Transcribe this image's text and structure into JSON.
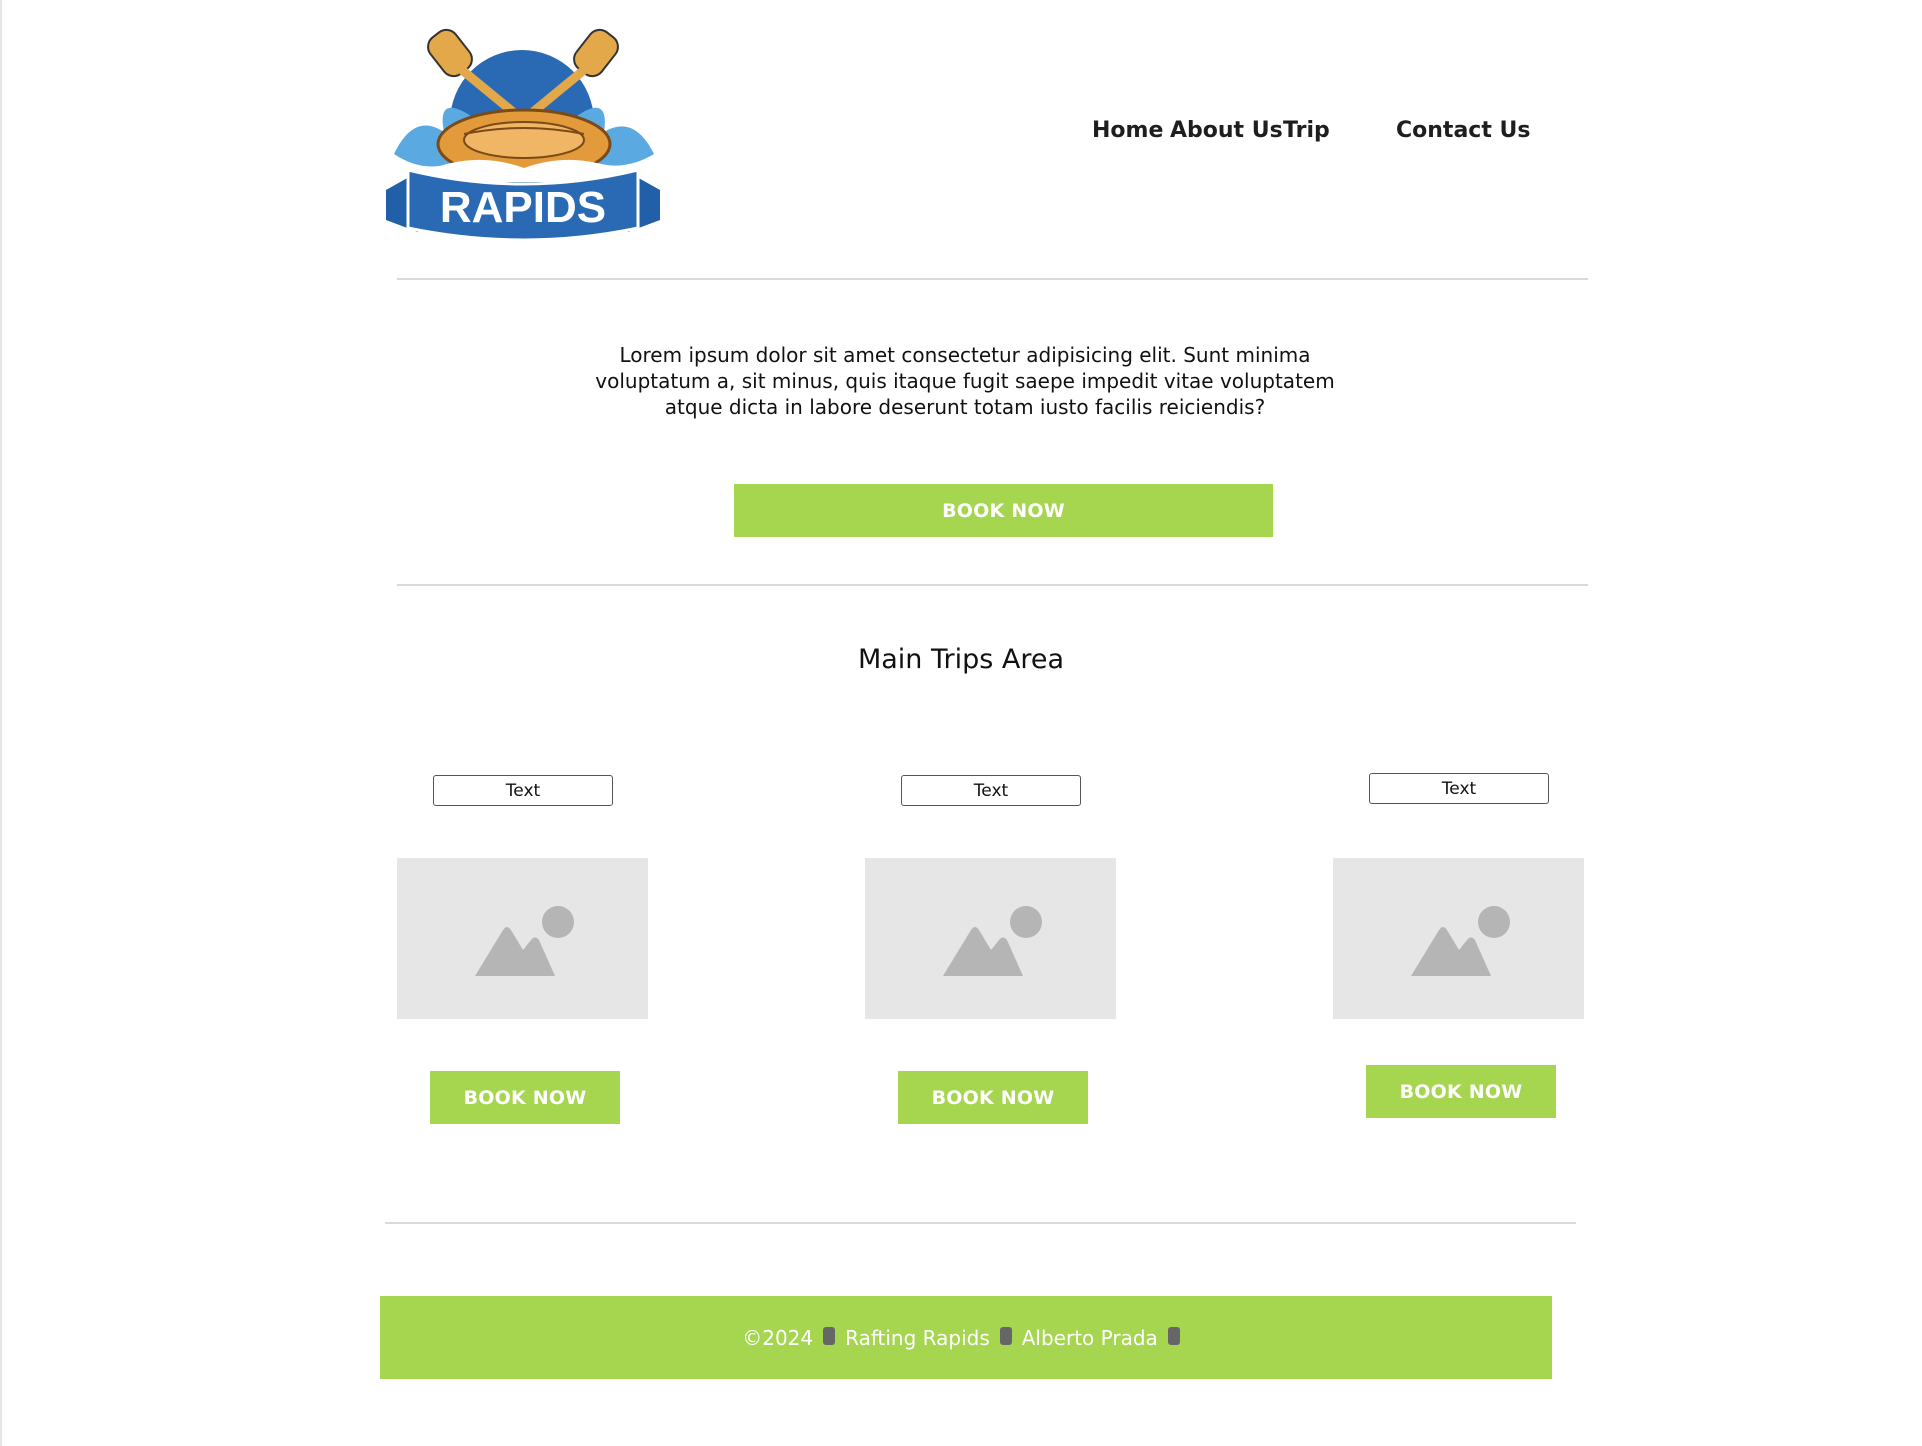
{
  "header": {
    "logo_text": "RAPIDS",
    "nav": [
      {
        "label": "Home"
      },
      {
        "label": "About Us"
      },
      {
        "label": "Trip"
      },
      {
        "label": "Contact Us"
      }
    ]
  },
  "hero": {
    "text": "Lorem ipsum dolor sit amet consectetur adipisicing elit. Sunt minima voluptatum a, sit minus, quis itaque fugit saepe impedit vitae voluptatem atque dicta in labore deserunt totam iusto facilis reiciendis?",
    "button_label": "BOOK NOW"
  },
  "trips": {
    "title": "Main Trips Area",
    "cards": [
      {
        "text": "Text",
        "button_label": "BOOK NOW"
      },
      {
        "text": "Text",
        "button_label": "BOOK NOW"
      },
      {
        "text": "Text",
        "button_label": "BOOK NOW"
      }
    ]
  },
  "footer": {
    "parts": [
      "©2024",
      "Rafting Rapids",
      "Alberto Prada"
    ]
  },
  "colors": {
    "accent_green": "#a6d650",
    "divider": "#d9d9d9",
    "placeholder": "#e6e6e6",
    "logo_blue": "#2a6ab5",
    "logo_orange": "#e39a3b"
  }
}
